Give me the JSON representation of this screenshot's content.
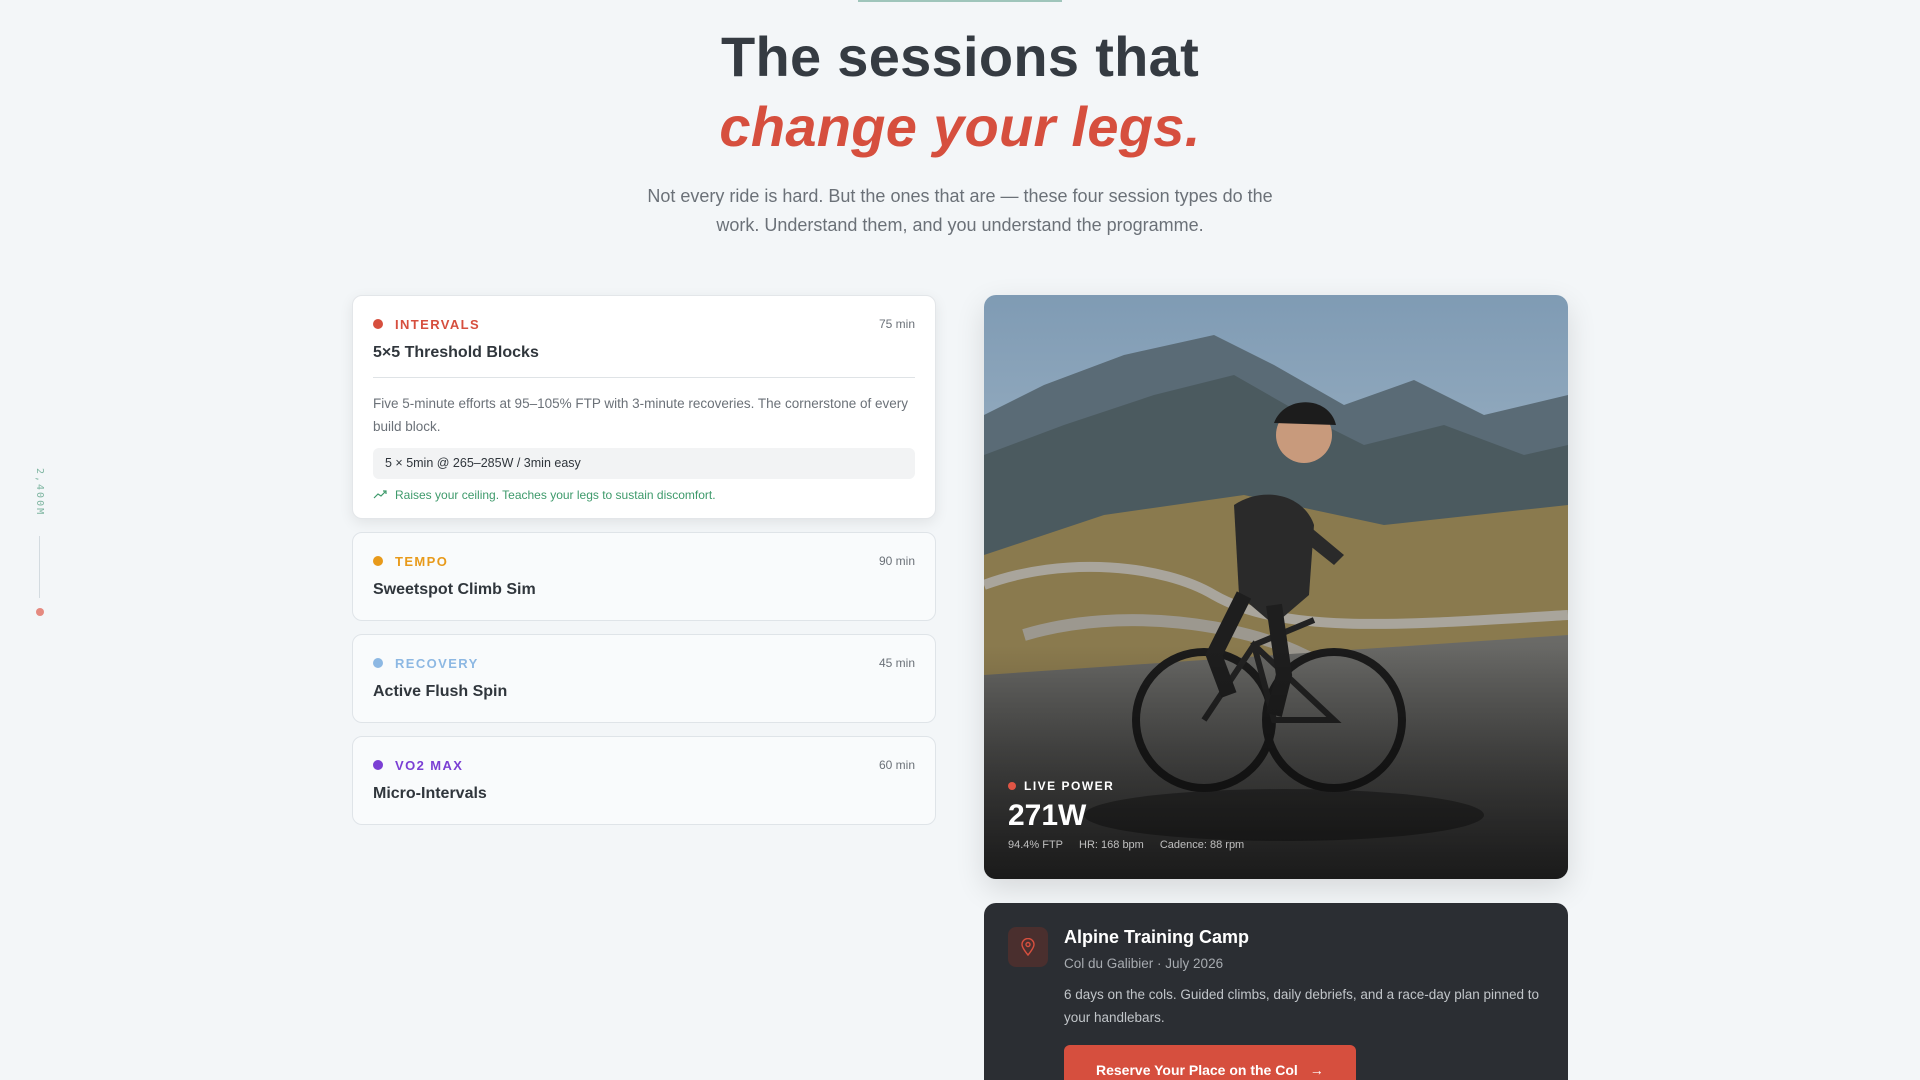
{
  "hero": {
    "title_line1": "The sessions that",
    "title_line2": "change your legs.",
    "subtitle": "Not every ride is hard. But the ones that are — these four session types do the work. Understand them, and you understand the programme."
  },
  "altitude": {
    "label": "2,400M"
  },
  "sessions": [
    {
      "category": "INTERVALS",
      "color": "#d64f3e",
      "duration": "75 min",
      "title": "5×5 Threshold Blocks",
      "description": "Five 5-minute efforts at 95–105% FTP with 3-minute recoveries. The cornerstone of every build block.",
      "spec": "5 × 5min @ 265–285W / 3min easy",
      "benefit": "Raises your ceiling. Teaches your legs to sustain discomfort."
    },
    {
      "category": "TEMPO",
      "color": "#e89a1a",
      "duration": "90 min",
      "title": "Sweetspot Climb Sim"
    },
    {
      "category": "RECOVERY",
      "color": "#8db8e3",
      "duration": "45 min",
      "title": "Active Flush Spin"
    },
    {
      "category": "VO2 MAX",
      "color": "#7b3fd4",
      "duration": "60 min",
      "title": "Micro-Intervals"
    }
  ],
  "photo": {
    "live_label": "LIVE POWER",
    "power": "271W",
    "ftp": "94.4% FTP",
    "hr": "HR: 168 bpm",
    "cadence": "Cadence: 88 rpm"
  },
  "camp": {
    "icon": "map-pin-icon",
    "title": "Alpine Training Camp",
    "subtitle": "Col du Galibier · July 2026",
    "description": "6 days on the cols. Guided climbs, daily debriefs, and a race-day plan pinned to your handlebars.",
    "button": "Reserve Your Place on the Col"
  }
}
